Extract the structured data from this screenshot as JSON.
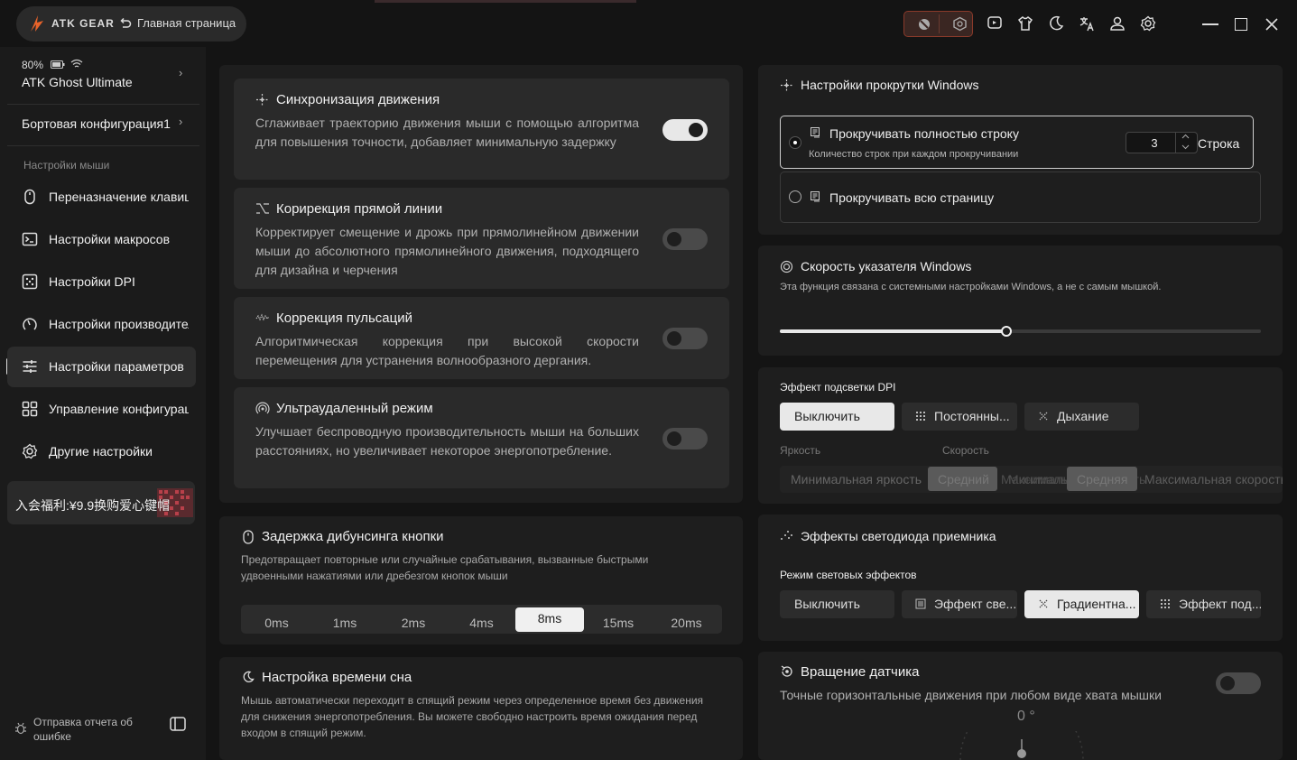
{
  "app": {
    "brand": "ATK GEAR",
    "home_label": "Главная страница"
  },
  "toolbar_icons": [
    "block-icon",
    "cube-icon",
    "feedback-icon",
    "shirt-icon",
    "moon-icon",
    "translate-icon",
    "user-icon",
    "gear-icon",
    "minimize-icon",
    "maximize-icon",
    "close-icon"
  ],
  "device": {
    "battery": "80%",
    "name": "ATK Ghost Ultimate",
    "config": "Бортовая конфигурация1"
  },
  "sidebar": {
    "section_label": "Настройки мыши",
    "items": [
      {
        "label": "Переназначение клавиш",
        "icon": "mouse-icon"
      },
      {
        "label": "Настройки макросов",
        "icon": "terminal-icon"
      },
      {
        "label": "Настройки DPI",
        "icon": "dpi-icon"
      },
      {
        "label": "Настройки производительности",
        "icon": "gauge-icon"
      },
      {
        "label": "Настройки параметров",
        "icon": "sliders-icon",
        "active": true
      },
      {
        "label": "Управление конфигурациями",
        "icon": "grid-icon"
      },
      {
        "label": "Другие настройки",
        "icon": "gear-icon"
      }
    ],
    "promo": "入会福利:¥9.9换购爱心键帽",
    "feedback": "Отправка отчета об ошибке"
  },
  "features": [
    {
      "title": "Синхронизация движения",
      "desc": "Сглаживает траекторию движения мыши с помощью алгоритма для повышения точности, добавляет минимальную задержку",
      "enabled": true
    },
    {
      "title": "Корирекция прямой линии",
      "desc": "Корректирует смещение и дрожь при прямолинейном движении мыши до абсолютного прямолинейного движения, подходящего для дизайна и черчения",
      "enabled": false
    },
    {
      "title": "Коррекция пульсаций",
      "desc": "Алгоритмическая коррекция при высокой скорости перемещения для устранения волнообразного дергания.",
      "enabled": false
    },
    {
      "title": "Ультраудаленный режим",
      "desc": "Улучшает беспроводную производительность мыши на больших расстояниях, но увеличивает некоторое энергопотребление.",
      "enabled": false
    }
  ],
  "debounce": {
    "title": "Задержка дибунсинга кнопки",
    "desc": "Предотвращает повторные или случайные срабатывания, вызванные быстрыми удвоенными нажатиями или дребезгом кнопок мыши",
    "options": [
      "0ms",
      "1ms",
      "2ms",
      "4ms",
      "8ms",
      "15ms",
      "20ms"
    ],
    "selected": "8ms"
  },
  "sleep": {
    "title": "Настройка времени сна",
    "desc": "Мышь автоматически переходит в спящий режим через определенное время без движения для снижения энергопотребления. Вы можете свободно настроить время ожидания перед входом в спящий режим."
  },
  "scroll": {
    "title": "Настройки прокрутки Windows",
    "opt1_label": "Прокручивать полностью строку",
    "opt1_sub": "Количество строк при каждом прокручивании",
    "lines_value": "3",
    "lines_unit": "Строка",
    "opt2_label": "Прокручивать всю страницу",
    "selected": 1
  },
  "pointer": {
    "title": "Скорость указателя Windows",
    "desc": "Эта функция связана с системными настройками Windows, а не с самым мышкой.",
    "value": 0.47
  },
  "dpi_light": {
    "title": "Эффект подсветки DPI",
    "buttons": [
      "Выключить",
      "Постоянны...",
      "Дыхание"
    ],
    "selected": "Выключить",
    "brightness_label": "Яркость",
    "speed_label": "Скорость",
    "brightness_options": [
      "Минимальная яркость",
      "Средний",
      "Максимальная яркость"
    ],
    "speed_options": [
      "Минимальная скорость",
      "Средняя",
      "Максимальная скорость"
    ]
  },
  "receiver_led": {
    "title": "Эффекты светодиода приемника",
    "mode_label": "Режим световых эффектов",
    "buttons": [
      "Выключить",
      "Эффект све...",
      "Градиентна...",
      "Эффект под..."
    ],
    "selected": "Градиентна..."
  },
  "rotation": {
    "title": "Вращение датчика",
    "desc": "Точные горизонтальные движения при любом виде хвата мышки",
    "angle": "0 °",
    "enabled": false
  }
}
